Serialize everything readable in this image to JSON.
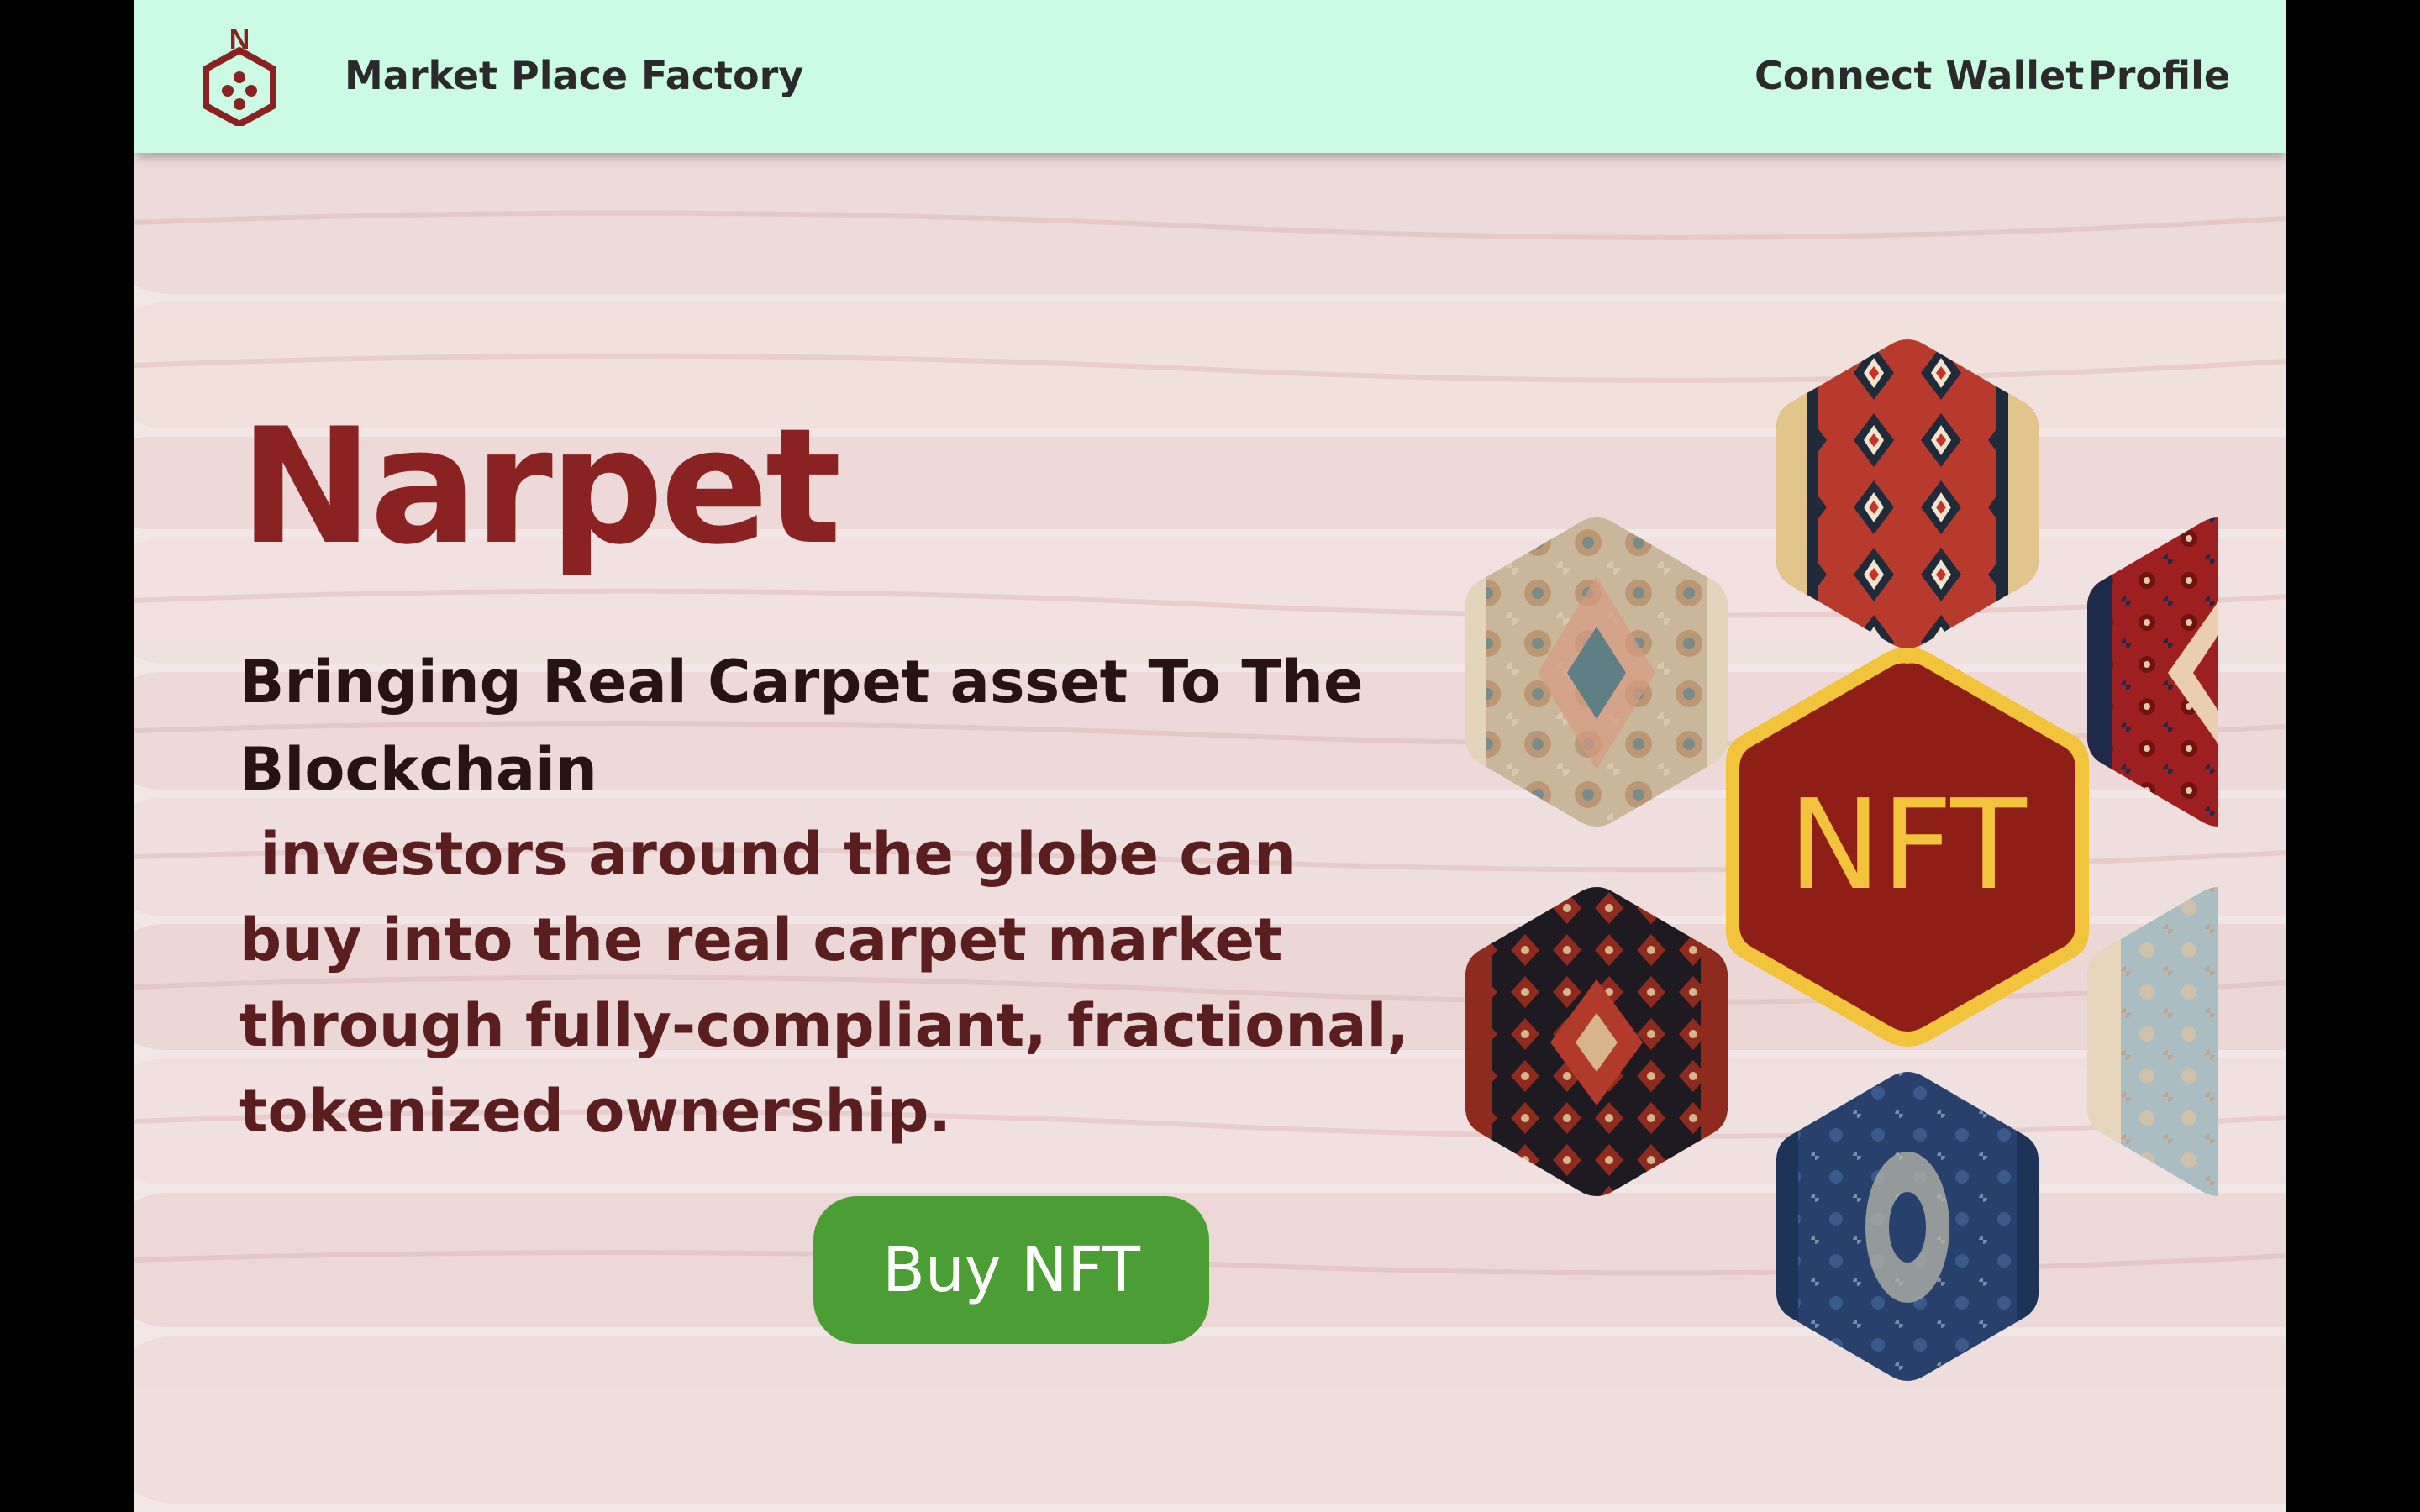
{
  "nav": {
    "logo_letter": "N",
    "market_place": "Market Place",
    "factory": "Factory",
    "connect_wallet": "Connect Wallet",
    "profile": "Profile"
  },
  "hero": {
    "title": "Narpet",
    "subtitle": "Bringing Real Carpet asset To The Blockchain",
    "description": " investors around the globe can buy into the real carpet market through fully-compliant, fractional, tokenized ownership.",
    "buy_button": "Buy NFT"
  },
  "nft_badge": {
    "label": "NFT"
  },
  "carpets": [
    {
      "name": "kilim-red-carpet"
    },
    {
      "name": "beige-medallion-carpet"
    },
    {
      "name": "red-persian-carpet"
    },
    {
      "name": "dark-tribal-carpet"
    },
    {
      "name": "light-blue-carpet"
    },
    {
      "name": "navy-blue-carpet"
    }
  ],
  "colors": {
    "nav_background": "#ccfbe5",
    "brand_red": "#8b2222",
    "button_green": "#4a9e34",
    "badge_red": "#8f1e16",
    "badge_gold": "#f2c43c"
  }
}
